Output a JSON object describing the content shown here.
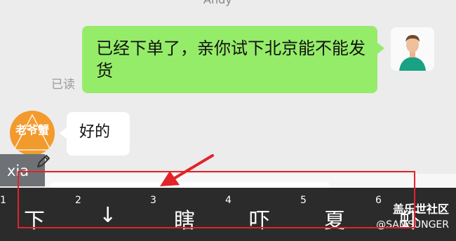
{
  "header": {
    "title_partial": "Andy"
  },
  "messages": [
    {
      "side": "right",
      "text": "已经下单了，亲你试下北京能不能发货",
      "status": "已读"
    },
    {
      "side": "left",
      "text": "好的",
      "avatar_text": "老爷蟹"
    }
  ],
  "ime": {
    "composing": "xia",
    "candidates": [
      {
        "num": "1",
        "char": "下"
      },
      {
        "num": "2",
        "char": "↓"
      },
      {
        "num": "3",
        "char": "瞎"
      },
      {
        "num": "4",
        "char": "吓"
      },
      {
        "num": "5",
        "char": "夏"
      },
      {
        "num": "6",
        "char": "虾"
      }
    ]
  },
  "watermark": {
    "line1": "盖乐世社区",
    "line2": "@SAMSUNGER"
  },
  "colors": {
    "my_bubble": "#95ec69",
    "annotation": "#e0242a",
    "candidate_bar": "#2b2b2b"
  }
}
